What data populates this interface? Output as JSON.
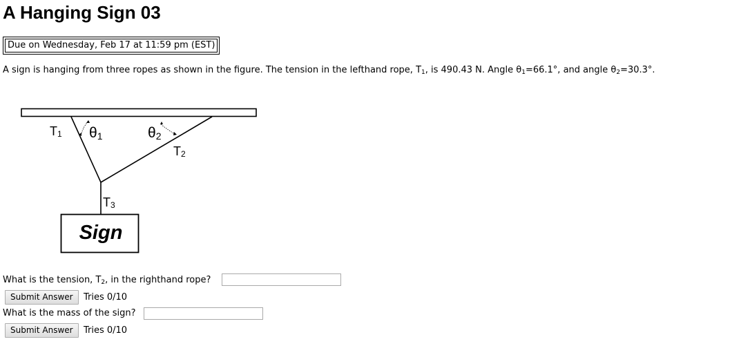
{
  "page": {
    "title": "A Hanging Sign 03",
    "due": "Due on Wednesday, Feb 17 at 11:59 pm (EST)"
  },
  "problem": {
    "part1": "A sign is hanging from three ropes as shown in the figure. The tension in the lefthand rope, T",
    "t1_sub": "1",
    "part2": ", is 490.43 N. Angle θ",
    "theta1_sub": "1",
    "part3": "=66.1°, and angle θ",
    "theta2_sub": "2",
    "part4": "=30.3°."
  },
  "figure": {
    "label_t1": "T",
    "label_t1_sub": "1",
    "label_theta1": "θ",
    "label_theta1_sub": "1",
    "label_theta2": "θ",
    "label_theta2_sub": "2",
    "label_t2": "T",
    "label_t2_sub": "2",
    "label_t3": "T",
    "label_t3_sub": "3",
    "sign_text": "Sign"
  },
  "questions": [
    {
      "text_before": "What is the tension, T",
      "text_sub": "2",
      "text_after": ", in the righthand rope?",
      "value": "",
      "submit_label": "Submit Answer",
      "tries": "Tries 0/10"
    },
    {
      "text_before": "What is the mass of the sign?",
      "text_sub": "",
      "text_after": "",
      "value": "",
      "submit_label": "Submit Answer",
      "tries": "Tries 0/10"
    }
  ]
}
